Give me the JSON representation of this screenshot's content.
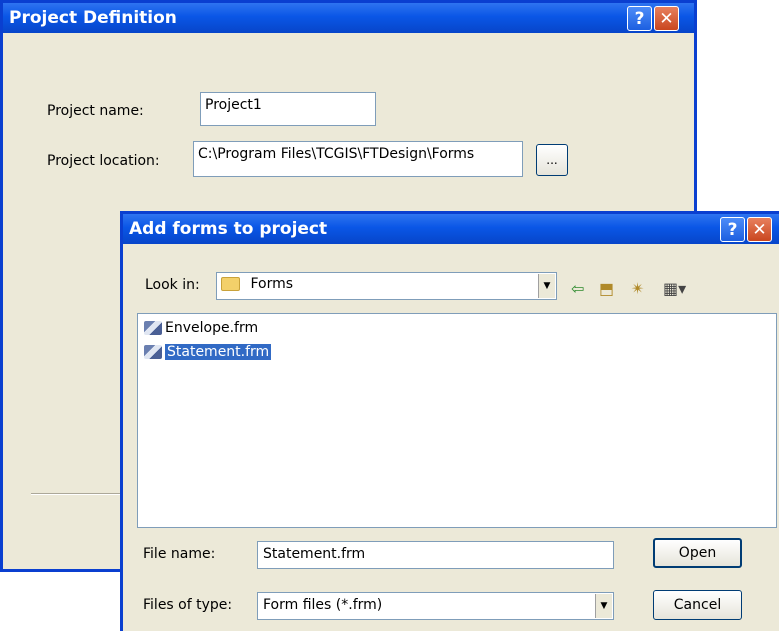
{
  "project_dialog": {
    "title": "Project Definition",
    "help_glyph": "?",
    "close_glyph": "✕",
    "name_label": "Project name:",
    "name_value": "Project1",
    "location_label": "Project location:",
    "location_value": "C:\\Program Files\\TCGIS\\FTDesign\\Forms",
    "browse_glyph": "..."
  },
  "add_dialog": {
    "title": "Add forms to project",
    "help_glyph": "?",
    "close_glyph": "✕",
    "lookin_label": "Look in:",
    "lookin_value": "Forms",
    "toolbar_icons": [
      "back-arrow-icon",
      "up-folder-icon",
      "new-folder-icon",
      "view-menu-icon"
    ],
    "files": [
      {
        "name": "Envelope.frm",
        "selected": false
      },
      {
        "name": "Statement.frm",
        "selected": true
      }
    ],
    "filename_label": "File name:",
    "filename_value": "Statement.frm",
    "filetype_label": "Files of type:",
    "filetype_value": "Form files (*.frm)",
    "open_label": "Open",
    "cancel_label": "Cancel"
  },
  "colors": {
    "titlebar": "#0a56e6",
    "selection": "#316ac5",
    "dialog_bg": "#ece9d8",
    "close_button": "#c9461f"
  }
}
